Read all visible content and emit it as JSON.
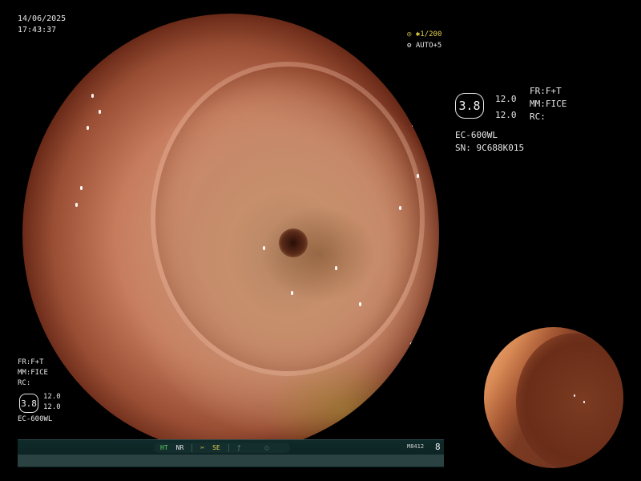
{
  "overlay": {
    "date": "14/06/2025",
    "time": "17:43:37",
    "shutter": "1/200",
    "exposure": "AUTO+5"
  },
  "settings_right": {
    "zoom_value": "3.8",
    "value_top": "12.0",
    "value_bottom": "12.0",
    "fr": "FR:F+T",
    "mm": "MM:FICE",
    "rc": "RC:",
    "model": "EC-600WL",
    "serial": "SN: 9C688K015"
  },
  "settings_left": {
    "fr": "FR:F+T",
    "mm": "MM:FICE",
    "rc": "RC:",
    "zoom_value": "3.8",
    "value_top": "12.0",
    "value_bottom": "12.0",
    "model": "EC-600WL"
  },
  "status_bar": {
    "ht": "HT",
    "nr": "NR",
    "se": "SE",
    "code": "M8412",
    "number": "8"
  },
  "colors": {
    "accent_yellow": "#e5d24a",
    "status_green": "#5fd35f",
    "background": "#000000"
  }
}
